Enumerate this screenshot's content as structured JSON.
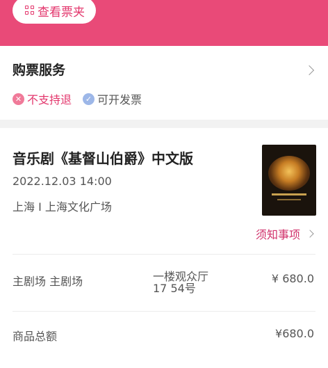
{
  "header": {
    "ticket_button_label": "查看票夹"
  },
  "ticket_service": {
    "title": "购票服务",
    "tags": [
      {
        "icon": "x-circle-icon",
        "label": "不支持退"
      },
      {
        "icon": "check-circle-icon",
        "label": "可开发票"
      }
    ]
  },
  "show": {
    "title": "音乐剧《基督山伯爵》中文版",
    "datetime": "2022.12.03 14:00",
    "venue": "上海 I 上海文化广场",
    "notice_link": "须知事项"
  },
  "order": {
    "session_label": "主剧场 主剧场",
    "seat_line1": "一楼观众厅",
    "seat_line2": "17 54号",
    "item_price": "¥ 680.0",
    "total_label": "商品总额",
    "total_value": "¥680.0"
  },
  "colors": {
    "brand_pink": "#e94a78",
    "accent_text": "#e3366c"
  }
}
